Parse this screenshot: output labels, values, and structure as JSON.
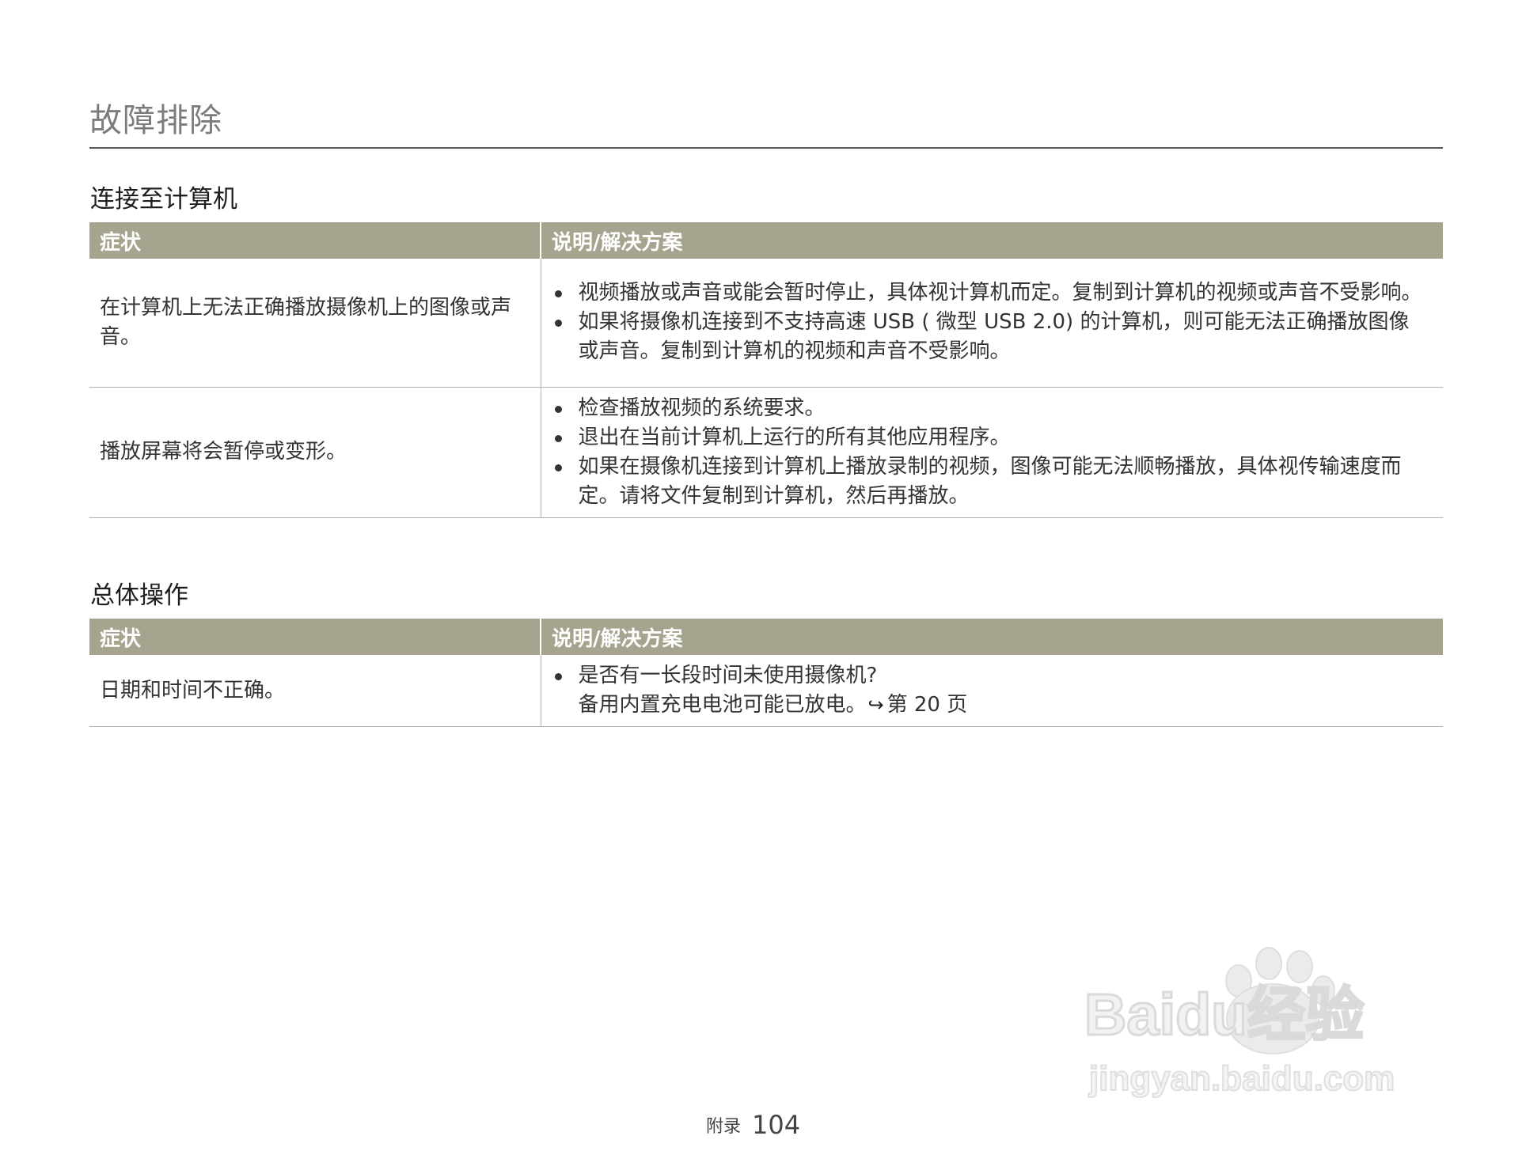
{
  "page": {
    "title": "故障排除"
  },
  "sections": [
    {
      "heading": "连接至计算机",
      "header_symptom": "症状",
      "header_solution": "说明/解决方案",
      "rows": [
        {
          "symptom": "在计算机上无法正确播放摄像机上的图像或声音。",
          "solutions": [
            "视频播放或声音或能会暂时停止，具体视计算机而定。复制到计算机的视频或声音不受影响。",
            "如果将摄像机连接到不支持高速 USB ( 微型 USB 2.0) 的计算机，则可能无法正确播放图像或声音。复制到计算机的视频和声音不受影响。"
          ]
        },
        {
          "symptom": "播放屏幕将会暂停或变形。",
          "solutions": [
            "检查播放视频的系统要求。",
            "退出在当前计算机上运行的所有其他应用程序。",
            "如果在摄像机连接到计算机上播放录制的视频，图像可能无法顺畅播放，具体视传输速度而定。请将文件复制到计算机，然后再播放。"
          ]
        }
      ]
    },
    {
      "heading": "总体操作",
      "header_symptom": "症状",
      "header_solution": "说明/解决方案",
      "rows": [
        {
          "symptom": "日期和时间不正确。",
          "solution_line1": "是否有一长段时间未使用摄像机?",
          "solution_line2": "备用内置充电电池可能已放电。",
          "arrow_icon": "↪",
          "page_ref": "第 20 页"
        }
      ]
    }
  ],
  "footer": {
    "label": "附录",
    "page_number": "104"
  },
  "watermark": {
    "brand": "Baidu经验",
    "url": "jingyan.baidu.com"
  }
}
